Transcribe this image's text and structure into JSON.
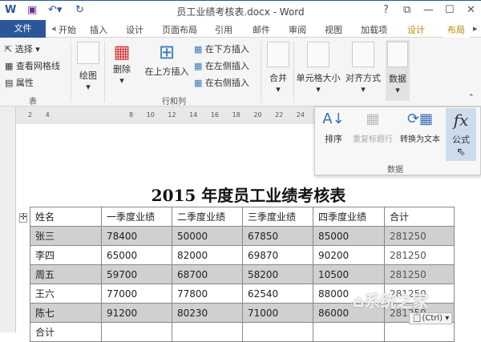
{
  "window": {
    "title": "员工业绩考核表.docx - Word",
    "help": "?",
    "controls": [
      "⧉",
      "—",
      "☐",
      "✕"
    ]
  },
  "tabs": {
    "file": "文件",
    "items": [
      "开始",
      "插入",
      "设计",
      "页面布局",
      "引用",
      "邮件",
      "审阅",
      "视图",
      "加载项",
      "设计",
      "布局"
    ]
  },
  "ribbon": {
    "table_group": {
      "select": "选择 ▾",
      "gridlines": "查看网格线",
      "properties": "属性",
      "label": "表"
    },
    "draw": "绘图",
    "delete": "删除",
    "insert_above": "在上方插入",
    "insert_below": "在下方插入",
    "insert_left": "在左侧插入",
    "insert_right": "在右侧插入",
    "rows_cols_label": "行和列",
    "merge": "合并",
    "cell_size": "单元格大小",
    "alignment": "对齐方式",
    "data": "数据"
  },
  "ruler": [
    "2",
    "4",
    "8",
    "10",
    "12",
    "14",
    "16",
    "18",
    "20",
    "22",
    "24"
  ],
  "popup": {
    "sort": "排序",
    "repeat_header": "重复标题行",
    "convert": "转换为文本",
    "formula": "公式",
    "formula_icon": "fx",
    "label": "数据"
  },
  "document": {
    "title": "2015 年度员工业绩考核表",
    "headers": [
      "姓名",
      "一季度业绩",
      "二季度业绩",
      "三季度业绩",
      "四季度业绩",
      "合计"
    ],
    "rows": [
      [
        "张三",
        "78400",
        "50000",
        "67850",
        "85000",
        "281250"
      ],
      [
        "李四",
        "65000",
        "82000",
        "69870",
        "90200",
        "281250"
      ],
      [
        "周五",
        "59700",
        "68700",
        "58200",
        "10500",
        "281250"
      ],
      [
        "王六",
        "77000",
        "77800",
        "62540",
        "88000",
        "281250"
      ],
      [
        "陈七",
        "91200",
        "80230",
        "71000",
        "86000",
        "281250"
      ],
      [
        "合计",
        "",
        "",
        "",
        "",
        ""
      ]
    ]
  },
  "paste_options": "(Ctrl) ▾",
  "watermark": "系统之家"
}
